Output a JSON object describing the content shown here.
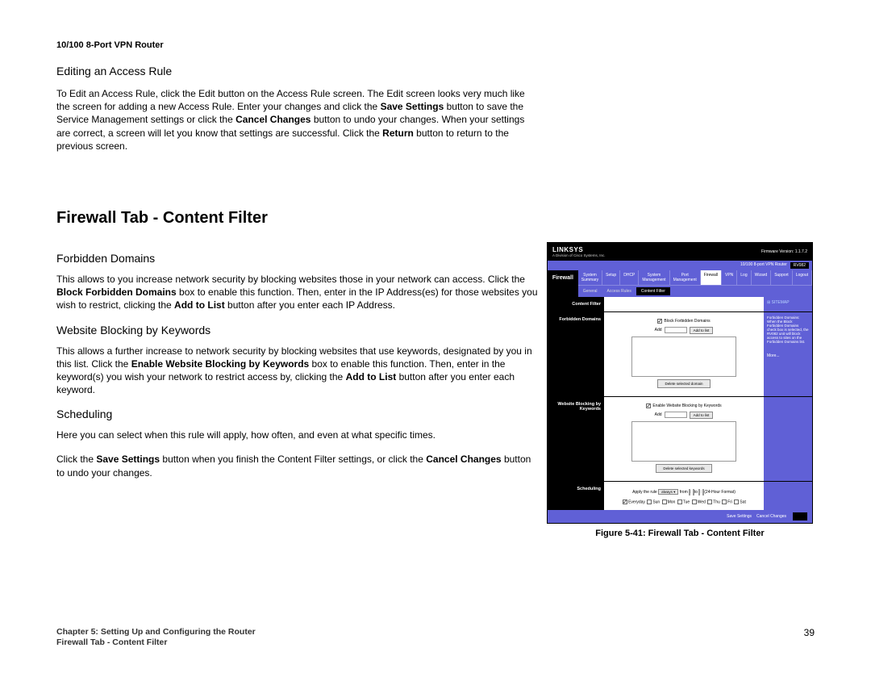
{
  "header": {
    "product": "10/100 8-Port VPN Router"
  },
  "sections": {
    "edit_heading": "Editing an Access Rule",
    "edit_p1_a": "To Edit an Access Rule, click the Edit button on the Access Rule screen. The Edit screen looks very much like the screen for adding a new Access Rule. Enter your changes and click the ",
    "edit_p1_b": "Save Settings",
    "edit_p1_c": " button to save the Service Management settings or click the ",
    "edit_p1_d": "Cancel Changes",
    "edit_p1_e": " button to undo your changes. When your settings are correct, a screen will let you know that settings are successful. Click the ",
    "edit_p1_f": "Return",
    "edit_p1_g": " button to return to the previous screen.",
    "main_heading": "Firewall Tab - Content Filter",
    "forbidden_heading": "Forbidden Domains",
    "forbidden_p_a": "This allows to you increase network security by blocking websites those in your network can access. Click the ",
    "forbidden_p_b": "Block Forbidden Domains",
    "forbidden_p_c": " box to enable this function. Then, enter in the IP Address(es) for those websites you wish to restrict, clicking the ",
    "forbidden_p_d": "Add to List",
    "forbidden_p_e": " button after you enter each IP Address.",
    "keywords_heading": "Website Blocking by Keywords",
    "keywords_p_a": "This allows a further increase to network security by blocking websites that use keywords, designated by you in this list. Click the ",
    "keywords_p_b": "Enable Website Blocking by Keywords",
    "keywords_p_c": " box to enable this function. Then, enter in the keyword(s) you wish your network to restrict access by, clicking the ",
    "keywords_p_d": "Add to List",
    "keywords_p_e": " button after you enter each keyword.",
    "sched_heading": "Scheduling",
    "sched_p1": "Here you can select when this rule will apply, how often, and even at what specific times.",
    "sched_p2_a": "Click the ",
    "sched_p2_b": "Save Settings",
    "sched_p2_c": " button when you finish the Content Filter settings, or click the ",
    "sched_p2_d": "Cancel Changes",
    "sched_p2_e": " button to undo your changes."
  },
  "figure": {
    "caption": "Figure 5-41: Firewall Tab - Content Filter"
  },
  "footer": {
    "chapter": "Chapter 5: Setting Up and Configuring the Router",
    "subtitle": "Firewall Tab - Content Filter",
    "page": "39"
  },
  "screenshot": {
    "brand": "LINKSYS",
    "brand_sub": "A Division of Cisco Systems, Inc.",
    "fw_version": "Firmware Version: 1.1.7.2",
    "model_title": "10/100 8-port VPN Router",
    "model_code": "RV082",
    "nav_title": "Firewall",
    "nav_items": [
      "System Summary",
      "Setup",
      "DHCP",
      "System Management",
      "Port Management",
      "Firewall",
      "VPN",
      "Log",
      "Wizard",
      "Support",
      "Logout"
    ],
    "subtabs": [
      "General",
      "Access Rules",
      "Content Filter"
    ],
    "side_labels": [
      "Content Filter",
      "Forbidden Domains",
      "Website Blocking by Keywords",
      "Scheduling"
    ],
    "block_forbidden": "Block Forbidden Domains",
    "enable_keywords": "Enable Website Blocking by Keywords",
    "add_label": "Add",
    "add_btn": "Add to list",
    "delete_btn": "Delete selected domain",
    "delete_btn2": "Delete selected keywords",
    "apply_rule": "Apply the rule",
    "apply_select": "always",
    "time_format": "(24-Hour Format)",
    "from": "from",
    "to": "to",
    "everyday": "Everyday",
    "days": [
      "Sun",
      "Mon",
      "Tue",
      "Wed",
      "Thu",
      "Fri",
      "Sat"
    ],
    "save": "Save Settings",
    "cancel": "Cancel Changes",
    "sitemap": "SITEMAP",
    "help_text": "Forbidden Domains: When the Block Forbidden Domains check box is selected, the RV082 unit will block access to sites on the Forbidden Domains list.",
    "more": "More..."
  }
}
